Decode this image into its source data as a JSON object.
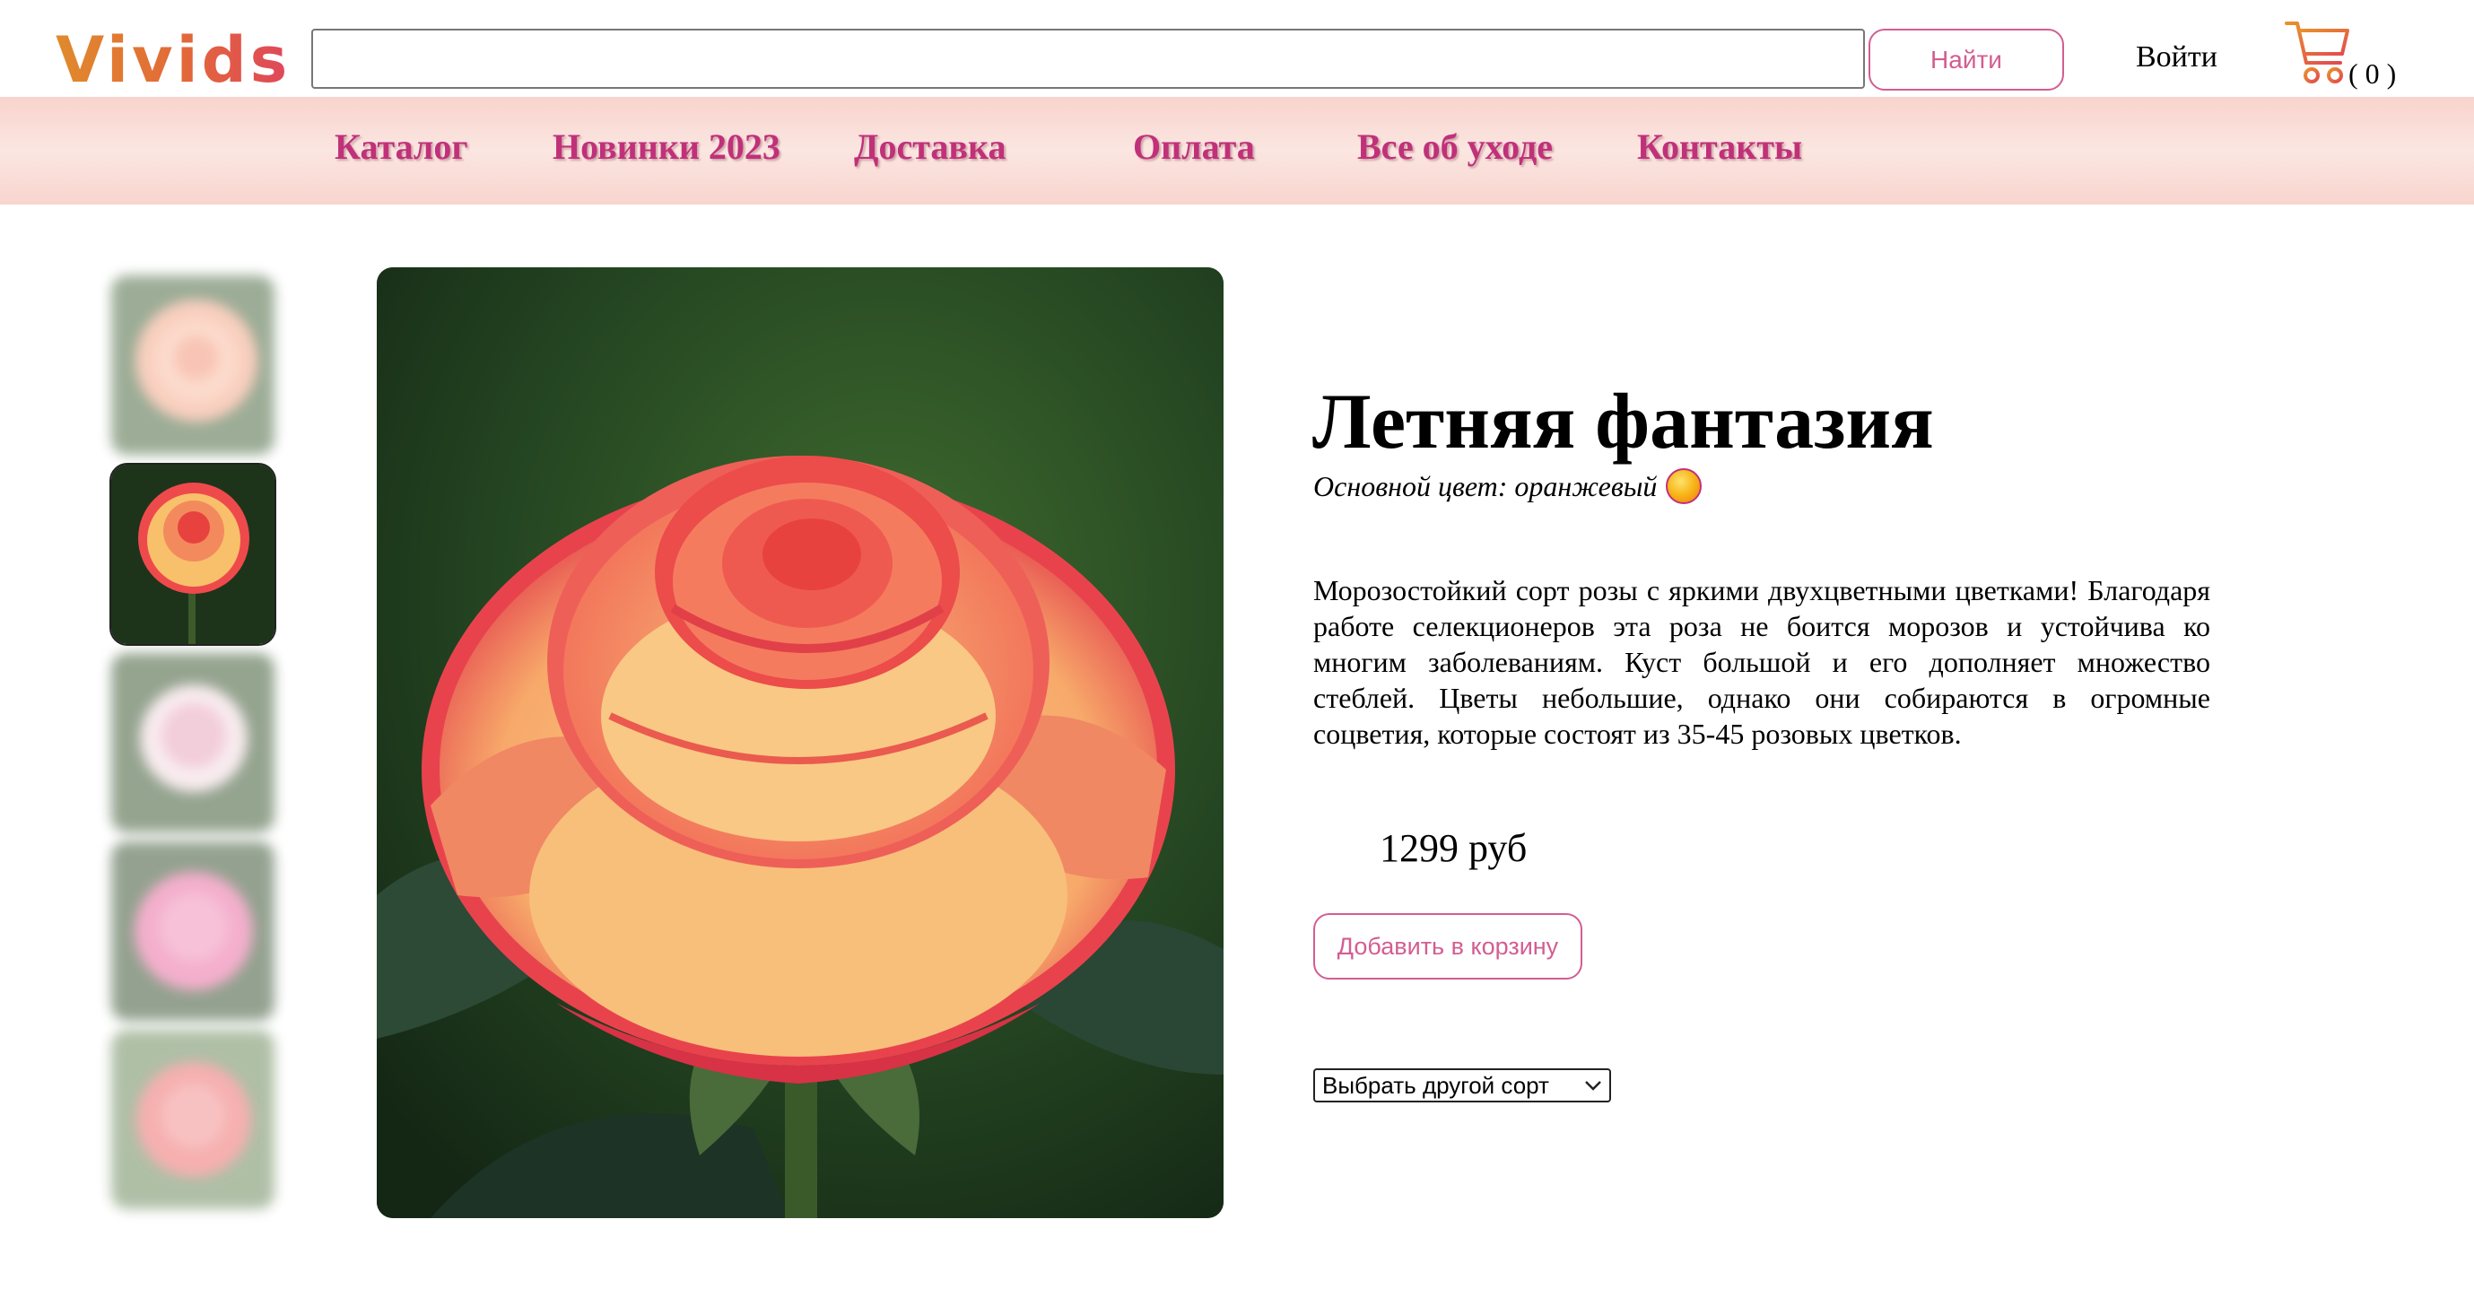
{
  "header": {
    "logo": "Vivids",
    "search_placeholder": "",
    "search_button": "Найти",
    "login": "Войти",
    "cart_count": "( 0 )"
  },
  "nav": {
    "items": [
      "Каталог",
      "Новинки 2023",
      "Доставка",
      "Оплата",
      "Все об уходе",
      "Контакты"
    ]
  },
  "product": {
    "title": "Летняя фантазия",
    "color_label": "Основной цвет: оранжевый",
    "description": "Морозостойкий сорт розы с яркими двухцветными цветками! Благодаря работе селекционеров эта роза не боится морозов и устойчива ко многим заболеваниям. Куст большой и его дополняет множество стеблей. Цветы небольшие, однако они собираются в огромные соцветия, которые состоят из 35-45 розовых цветков.",
    "price": "1299 руб",
    "add_to_cart": "Добавить в корзину",
    "select_variety": "Выбрать другой сорт"
  },
  "colors": {
    "accent": "#d35d92",
    "nav_text": "#c0317a",
    "nav_bar": "#f9d3cd"
  },
  "gallery": {
    "thumbnails": [
      "peach rose",
      "yellow-red rose",
      "white-pink rose",
      "pink rose",
      "coral rose"
    ],
    "selected_index": 1
  }
}
